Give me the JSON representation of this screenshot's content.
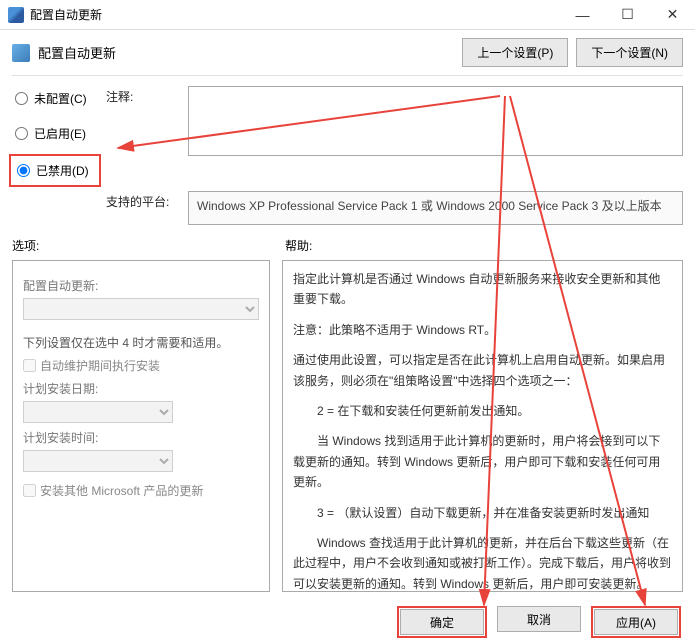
{
  "titlebar": {
    "title": "配置自动更新",
    "min": "—",
    "max": "☐",
    "close": "✕"
  },
  "header": {
    "title": "配置自动更新",
    "prev_btn": "上一个设置(P)",
    "next_btn": "下一个设置(N)"
  },
  "radios": {
    "not_configured": "未配置(C)",
    "enabled": "已启用(E)",
    "disabled": "已禁用(D)"
  },
  "labels": {
    "comment": "注释:",
    "platform": "支持的平台:",
    "options_header": "选项:",
    "help_header": "帮助:"
  },
  "platform_text": "Windows XP Professional Service Pack 1 或 Windows 2000 Service Pack 3 及以上版本",
  "options": {
    "title": "配置自动更新:",
    "note": "下列设置仅在选中 4 时才需要和适用。",
    "auto_maint": "自动维护期间执行安装",
    "plan_date": "计划安装日期:",
    "plan_time": "计划安装时间:",
    "other_ms": "安装其他 Microsoft 产品的更新"
  },
  "help": {
    "p1": "指定此计算机是否通过 Windows 自动更新服务来接收安全更新和其他重要下载。",
    "p2": "注意：此策略不适用于 Windows RT。",
    "p3": "通过使用此设置，可以指定是否在此计算机上启用自动更新。如果启用该服务，则必须在\"组策略设置\"中选择四个选项之一：",
    "p4": "　　2 = 在下载和安装任何更新前发出通知。",
    "p5": "　　当 Windows 找到适用于此计算机的更新时，用户将会接到可以下载更新的通知。转到 Windows 更新后，用户即可下载和安装任何可用更新。",
    "p6": "　　3 = （默认设置）自动下载更新，并在准备安装更新时发出通知",
    "p7": "　　Windows 查找适用于此计算机的更新，并在后台下载这些更新（在此过程中，用户不会收到通知或被打断工作）。完成下载后，用户将收到可以安装更新的通知。转到 Windows 更新后，用户即可安装更新。"
  },
  "buttons": {
    "ok": "确定",
    "cancel": "取消",
    "apply": "应用(A)"
  }
}
